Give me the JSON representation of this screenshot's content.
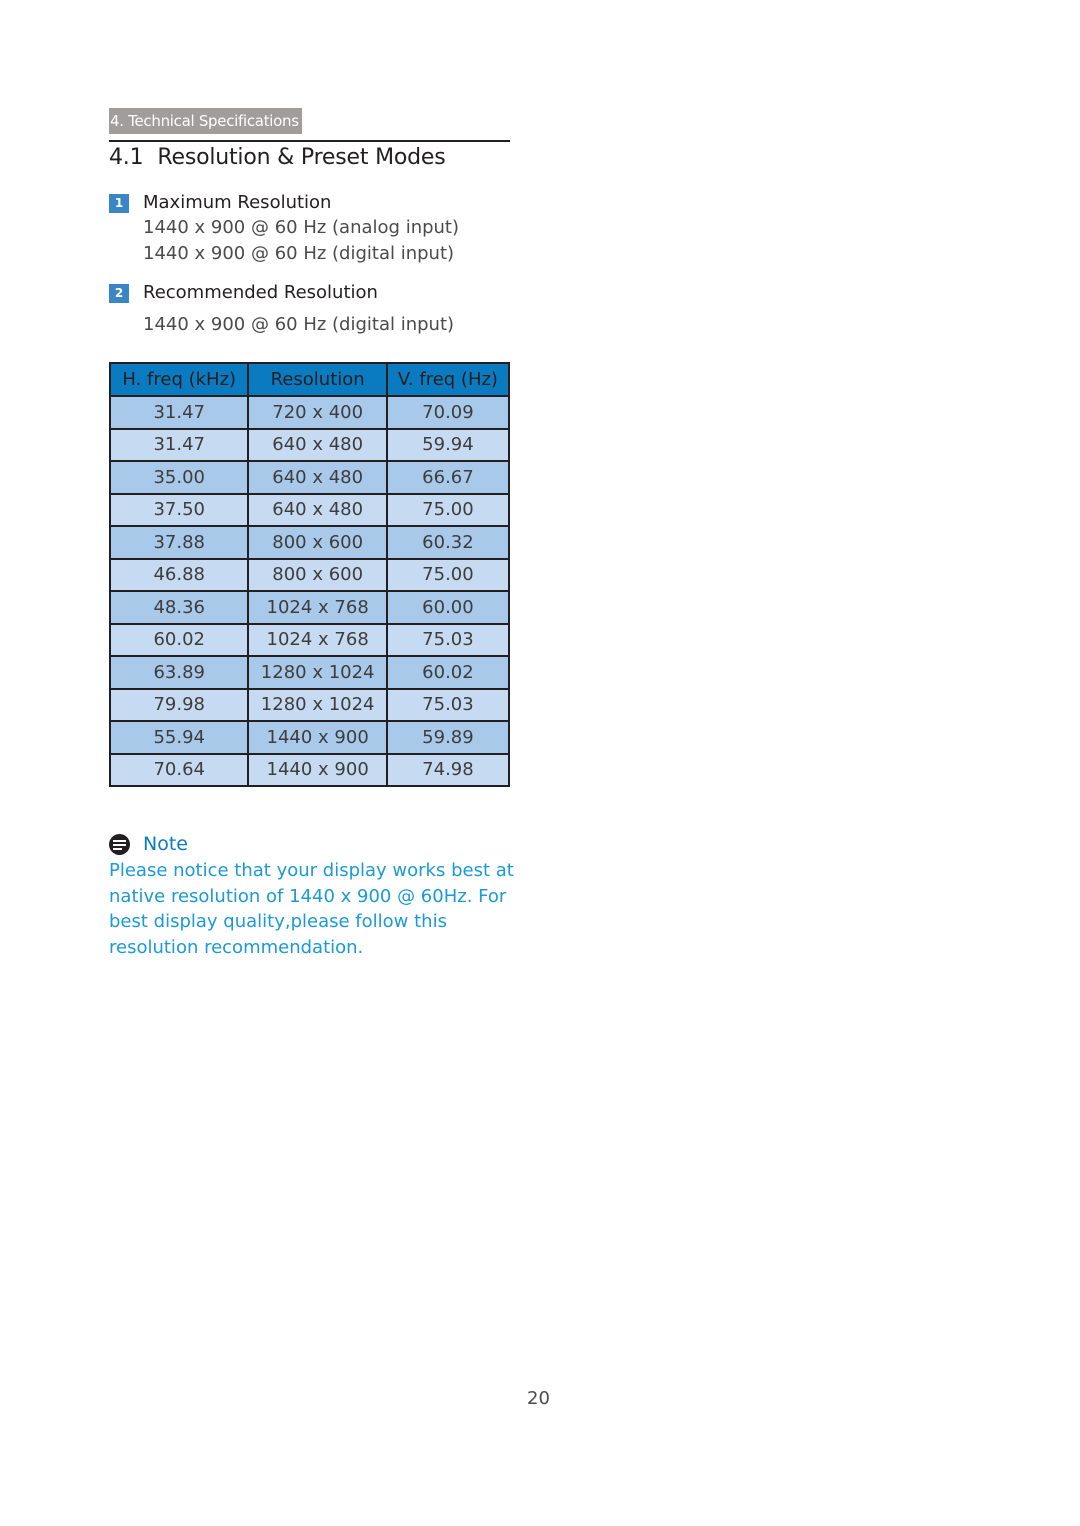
{
  "section_tag": "4. Technical Specifications",
  "section": {
    "number": "4.1",
    "title": "Resolution & Preset Modes"
  },
  "items": [
    {
      "badge": "1",
      "heading": "Maximum Resolution",
      "lines": [
        "1440 x 900 @ 60 Hz (analog input)",
        "1440 x 900 @ 60 Hz (digital input)"
      ]
    },
    {
      "badge": "2",
      "heading": "Recommended Resolution",
      "lines": [
        "1440 x 900 @ 60 Hz (digital input)"
      ]
    }
  ],
  "table": {
    "headers": [
      "H. freq (kHz)",
      "Resolution",
      "V. freq (Hz)"
    ],
    "rows": [
      [
        "31.47",
        "720 x 400",
        "70.09"
      ],
      [
        "31.47",
        "640 x 480",
        "59.94"
      ],
      [
        "35.00",
        "640 x 480",
        "66.67"
      ],
      [
        "37.50",
        "640 x 480",
        "75.00"
      ],
      [
        "37.88",
        "800 x 600",
        "60.32"
      ],
      [
        "46.88",
        "800 x 600",
        "75.00"
      ],
      [
        "48.36",
        "1024 x 768",
        "60.00"
      ],
      [
        "60.02",
        "1024 x 768",
        "75.03"
      ],
      [
        "63.89",
        "1280 x 1024",
        "60.02"
      ],
      [
        "79.98",
        "1280 x 1024",
        "75.03"
      ],
      [
        "55.94",
        "1440 x 900",
        "59.89"
      ],
      [
        "70.64",
        "1440 x 900",
        "74.98"
      ]
    ]
  },
  "note": {
    "icon": "note-icon",
    "label": "Note",
    "text": "Please notice that your display works best at native resolution of 1440 x 900 @ 60Hz. For best display quality,please follow this resolution recommendation."
  },
  "colors": {
    "header_blue": "#0a7bc1",
    "row_dark": "#a9c9ea",
    "row_light": "#c6dbf1",
    "note_blue": "#1a9ad7",
    "badge_blue": "#3a86c4",
    "tag_gray": "#a09d9c"
  },
  "page_number": "20"
}
